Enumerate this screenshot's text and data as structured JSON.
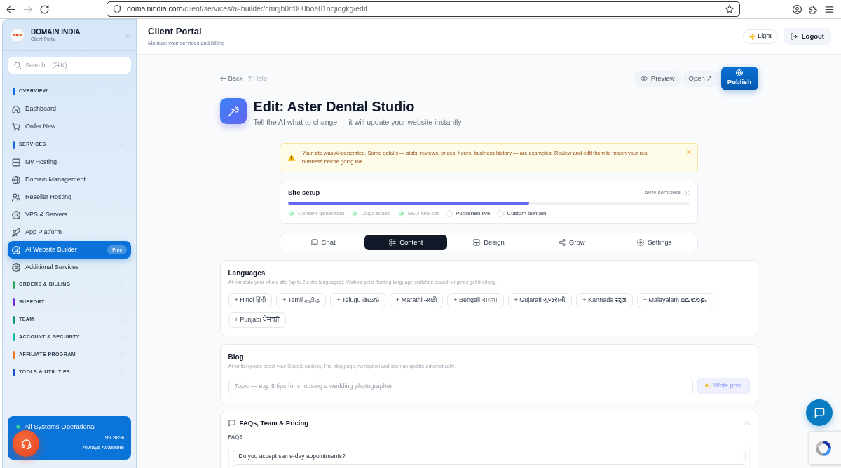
{
  "browser": {
    "url_domain": "domainindia.com",
    "url_path": "/client/services/ai-builder/cmrjjb0rr000boa01ncjiogkg/edit",
    "forward_disabled": true
  },
  "sidebar": {
    "brand": {
      "name": "DOMAIN INDIA",
      "subtitle": "Client Portal"
    },
    "search": {
      "placeholder": "Search... (⌘K)"
    },
    "sections": [
      {
        "label": "OVERVIEW",
        "color": "#1769d6",
        "expanded": true,
        "items": [
          {
            "label": "Dashboard",
            "selected": false
          },
          {
            "label": "Order New",
            "selected": false
          }
        ]
      },
      {
        "label": "SERVICES",
        "color": "#1769d6",
        "expanded": true,
        "items": [
          {
            "label": "My Hosting",
            "selected": false
          },
          {
            "label": "Domain Management",
            "selected": false
          },
          {
            "label": "Reseller Hosting",
            "selected": false
          },
          {
            "label": "VPS & Servers",
            "selected": false
          },
          {
            "label": "App Platform",
            "selected": false
          },
          {
            "label": "AI Website Builder",
            "selected": true,
            "badge": "Free"
          },
          {
            "label": "Additional Services",
            "selected": false
          }
        ]
      },
      {
        "label": "ORDERS & BILLING",
        "color": "#22a35a",
        "expanded": false
      },
      {
        "label": "SUPPORT",
        "color": "#6d28d9",
        "expanded": false
      },
      {
        "label": "TEAM",
        "color": "#0f8f86",
        "expanded": false
      },
      {
        "label": "ACCOUNT & SECURITY",
        "color": "#14b8a6",
        "expanded": false
      },
      {
        "label": "AFFILIATE PROGRAM",
        "color": "#f0731e",
        "expanded": false
      },
      {
        "label": "TOOLS & UTILITIES",
        "color": "#1d4fc4",
        "expanded": false
      }
    ],
    "status": {
      "title": "All Systems Operational",
      "uptime": "99.98%",
      "note": "Always Available"
    }
  },
  "header": {
    "title": "Client Portal",
    "subtitle": "Manage your services and billing",
    "theme_button": "Light",
    "logout_button": "Logout"
  },
  "editor": {
    "back_link": "Back",
    "help_link": "? Help",
    "preview_button": "Preview",
    "open_button": "Open ↗",
    "publish_button": "Publish",
    "title": "Edit: Aster Dental Studio",
    "subtitle": "Tell the AI what to change — it will update your website instantly",
    "notice": "Your site was AI-generated. Some details — stats, reviews, prices, hours, business history — are examples. Review and edit them to match your real business before going live.",
    "setup": {
      "title": "Site setup",
      "progress_text": "60% complete",
      "level": 0.6,
      "steps": [
        {
          "label": "Content generated",
          "done": true
        },
        {
          "label": "Logo added",
          "done": true
        },
        {
          "label": "SEO title set",
          "done": true
        },
        {
          "label": "Published live",
          "done": false
        },
        {
          "label": "Custom domain",
          "done": false
        }
      ]
    },
    "tabs": [
      {
        "label": "Chat",
        "selected": false
      },
      {
        "label": "Content",
        "selected": true
      },
      {
        "label": "Design",
        "selected": false
      },
      {
        "label": "Grow",
        "selected": false
      },
      {
        "label": "Settings",
        "selected": false
      }
    ],
    "languages": {
      "title": "Languages",
      "description": "AI-translate your whole site (up to 2 extra languages). Visitors get a floating language switcher; search engines get hreflang.",
      "options": [
        "+ Hindi हिंदी",
        "+ Tamil தமிழ்",
        "+ Telugu తెలుగు",
        "+ Marathi मराठी",
        "+ Bengali বাংলা",
        "+ Gujarati ગુજરાતી",
        "+ Kannada ಕನ್ನಡ",
        "+ Malayalam മലയാളം",
        "+ Punjabi ਪੰਜਾਬੀ"
      ]
    },
    "blog": {
      "title": "Blog",
      "description": "AI-written posts boost your Google ranking. The blog page, navigation and sitemap update automatically.",
      "topic_placeholder": "Topic — e.g. 5 tips for choosing a wedding photographer",
      "write_button": {
        "label": "Write post",
        "disabled": true
      }
    },
    "faq_panel": {
      "title": "FAQs, Team & Pricing",
      "expanded": true,
      "section_label": "FAQS",
      "faqs": [
        {
          "question": "Do you accept same-day appointments?"
        }
      ]
    }
  }
}
